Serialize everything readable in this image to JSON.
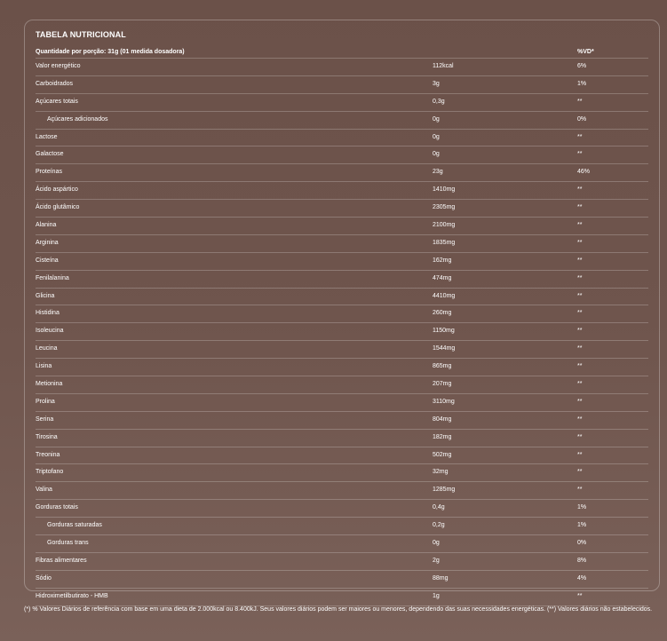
{
  "table": {
    "title": "TABELA NUTRICIONAL",
    "header": {
      "portion": "Quantidade por porção: 31g (01 medida dosadora)",
      "vd": "%VD*"
    },
    "rows": [
      {
        "name": "Valor energético",
        "amount": "112kcal",
        "vd": "6%",
        "sub": false
      },
      {
        "name": "Carboidrados",
        "amount": "3g",
        "vd": "1%",
        "sub": false
      },
      {
        "name": "Açúcares totais",
        "amount": "0,3g",
        "vd": "**",
        "sub": false
      },
      {
        "name": "Açúcares adicionados",
        "amount": "0g",
        "vd": "0%",
        "sub": true
      },
      {
        "name": "Lactose",
        "amount": "0g",
        "vd": "**",
        "sub": false
      },
      {
        "name": "Galactose",
        "amount": "0g",
        "vd": "**",
        "sub": false
      },
      {
        "name": "Proteínas",
        "amount": "23g",
        "vd": "46%",
        "sub": false
      },
      {
        "name": "Ácido aspártico",
        "amount": "1410mg",
        "vd": "**",
        "sub": false
      },
      {
        "name": "Ácido glutâmico",
        "amount": "2305mg",
        "vd": "**",
        "sub": false
      },
      {
        "name": "Alanina",
        "amount": "2100mg",
        "vd": "**",
        "sub": false
      },
      {
        "name": "Arginina",
        "amount": "1835mg",
        "vd": "**",
        "sub": false
      },
      {
        "name": "Cisteína",
        "amount": "162mg",
        "vd": "**",
        "sub": false
      },
      {
        "name": "Fenilalanina",
        "amount": "474mg",
        "vd": "**",
        "sub": false
      },
      {
        "name": "Glicina",
        "amount": "4410mg",
        "vd": "**",
        "sub": false
      },
      {
        "name": "Histidina",
        "amount": "260mg",
        "vd": "**",
        "sub": false
      },
      {
        "name": "Isoleucina",
        "amount": "1150mg",
        "vd": "**",
        "sub": false
      },
      {
        "name": "Leucina",
        "amount": "1544mg",
        "vd": "**",
        "sub": false
      },
      {
        "name": "Lisina",
        "amount": "865mg",
        "vd": "**",
        "sub": false
      },
      {
        "name": "Metionina",
        "amount": "207mg",
        "vd": "**",
        "sub": false
      },
      {
        "name": "Prolina",
        "amount": "3110mg",
        "vd": "**",
        "sub": false
      },
      {
        "name": "Serina",
        "amount": "804mg",
        "vd": "**",
        "sub": false
      },
      {
        "name": "Tirosina",
        "amount": "182mg",
        "vd": "**",
        "sub": false
      },
      {
        "name": "Treonina",
        "amount": "502mg",
        "vd": "**",
        "sub": false
      },
      {
        "name": "Triptofano",
        "amount": "32mg",
        "vd": "**",
        "sub": false
      },
      {
        "name": "Valina",
        "amount": "1285mg",
        "vd": "**",
        "sub": false
      },
      {
        "name": "Gorduras totais",
        "amount": "0,4g",
        "vd": "1%",
        "sub": false
      },
      {
        "name": "Gorduras saturadas",
        "amount": "0,2g",
        "vd": "1%",
        "sub": true
      },
      {
        "name": "Gorduras trans",
        "amount": "0g",
        "vd": "0%",
        "sub": true
      },
      {
        "name": "Fibras alimentares",
        "amount": "2g",
        "vd": "8%",
        "sub": false
      },
      {
        "name": "Sódio",
        "amount": "88mg",
        "vd": "4%",
        "sub": false
      },
      {
        "name": "Hidroximetilbutirato - HMB",
        "amount": "1g",
        "vd": "**",
        "sub": false
      }
    ]
  },
  "footnote": "(*) % Valores Diários de referência com base em uma dieta de 2.000kcal ou 8.400kJ. Seus valores diários podem ser maiores ou menores, dependendo das suas necessidades energéticas. (**) Valores diários não estabelecidos.",
  "colors": {
    "background": "#6f554d",
    "text": "#ffffff"
  }
}
